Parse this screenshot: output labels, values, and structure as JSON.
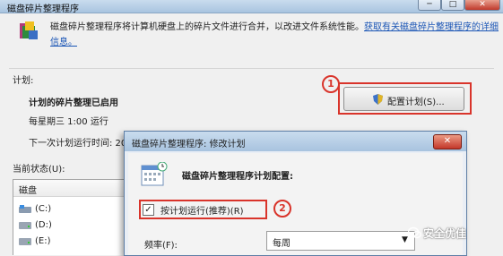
{
  "window": {
    "title": "磁盘碎片整理程序",
    "controls": {
      "minimize": "─",
      "maximize": "□",
      "close": "✕"
    }
  },
  "intro": {
    "text": "磁盘碎片整理程序将计算机硬盘上的碎片文件进行合并，以改进文件系统性能。",
    "link": "获取有关磁盘碎片整理程序的详细信息。"
  },
  "schedule": {
    "section_label": "计划:",
    "status": "计划的碎片整理已启用",
    "run_time": "每星期三  1:00  运行",
    "next_run": "下一次计划运行时间: 20",
    "configure_button": "配置计划(S)..."
  },
  "current": {
    "label": "当前状态(U):",
    "header": "磁盘",
    "drives": [
      "(C:)",
      "(D:)",
      "(E:)"
    ]
  },
  "dialog": {
    "title": "磁盘碎片整理程序: 修改计划",
    "close": "✕",
    "heading": "磁盘碎片整理程序计划配置:",
    "checkbox_label": "按计划运行(推荐)(R)",
    "checkbox_checked": true,
    "frequency_label": "频率(F):",
    "frequency_value": "每周"
  },
  "annotations": {
    "one": "1",
    "two": "2"
  },
  "watermark": "安全优佳",
  "colors": {
    "annotation": "#d9342b",
    "link": "#1a55b5",
    "titlebar": "#b9d0e8"
  }
}
